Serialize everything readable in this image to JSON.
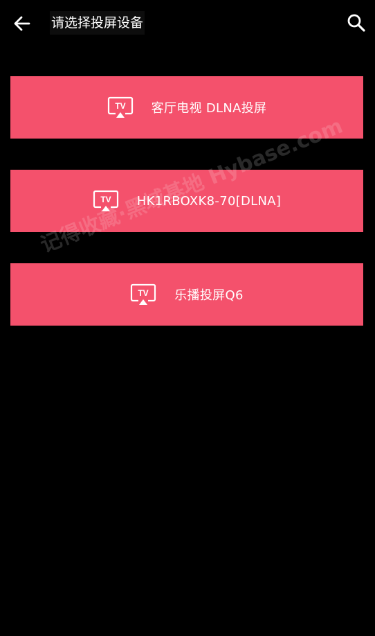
{
  "header": {
    "title": "请选择投屏设备",
    "back_icon": "arrow-left-icon",
    "search_icon": "search-icon"
  },
  "devices": [
    {
      "label": "客厅电视 DLNA投屏",
      "icon": "tv-cast-icon",
      "icon_text": "TV"
    },
    {
      "label": "HK1RBOXK8-70[DLNA]",
      "icon": "tv-cast-icon",
      "icon_text": "TV"
    },
    {
      "label": "乐播投屏Q6",
      "icon": "tv-cast-icon",
      "icon_text": "TV"
    }
  ],
  "watermark": {
    "text": "记得收藏·黑域基地 Hybase.com"
  },
  "colors": {
    "background": "#000000",
    "accent": "#f4516c",
    "text": "#ffffff"
  }
}
